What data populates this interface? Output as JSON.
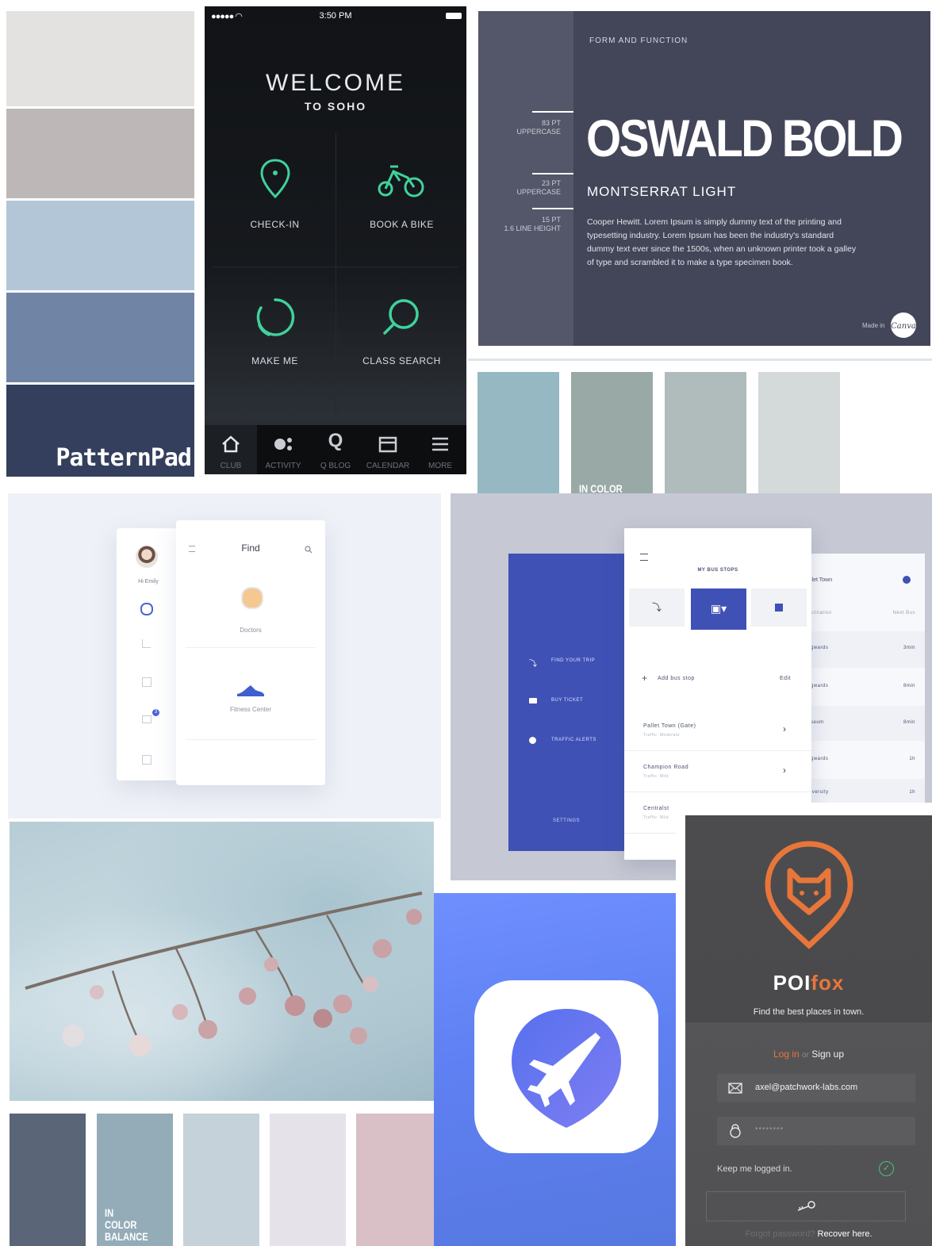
{
  "palette_left": {
    "colors": [
      "#e4e2e1",
      "#bdb8b7",
      "#b3c6d8",
      "#7085a6",
      "#333f5c"
    ],
    "logo": "PatternPad"
  },
  "soho": {
    "status": {
      "time": "3:50 PM"
    },
    "title": "WELCOME",
    "subtitle": "TO SOHO",
    "tiles": [
      {
        "label": "CHECK-IN",
        "icon": "location-pin-icon"
      },
      {
        "label": "BOOK A BIKE",
        "icon": "bicycle-icon"
      },
      {
        "label": "MAKE ME",
        "icon": "loop-icon"
      },
      {
        "label": "CLASS SEARCH",
        "icon": "search-icon"
      }
    ],
    "tabs": [
      {
        "label": "CLUB",
        "icon": "home-icon"
      },
      {
        "label": "ACTIVITY",
        "icon": "activity-icon"
      },
      {
        "label": "Q BLOG",
        "icon": "q-icon"
      },
      {
        "label": "CALENDAR",
        "icon": "calendar-icon"
      },
      {
        "label": "MORE",
        "icon": "menu-icon"
      }
    ],
    "accent": "#3fd29b"
  },
  "typography": {
    "kicker": "FORM AND FUNCTION",
    "specs": [
      {
        "size": "83 PT",
        "case": "UPPERCASE"
      },
      {
        "size": "23 PT",
        "case": "UPPERCASE"
      },
      {
        "size": "15 PT",
        "case": "1.6 LINE HEIGHT"
      }
    ],
    "headline": "OSWALD BOLD",
    "subhead": "MONTSERRAT LIGHT",
    "body": "Cooper Hewitt. Lorem Ipsum is simply dummy text of the printing and typesetting industry. Lorem Ipsum has been the industry's standard dummy text ever since the 1500s, when an unknown printer took a galley of type and scrambled it to make a type specimen book.",
    "made_in": "Made in",
    "brand": "Canva"
  },
  "palette_right": {
    "colors": [
      "#96b8c2",
      "#99a9a6",
      "#b0bcbc",
      "#d4d9da"
    ],
    "caption": "IN COLOR BALANCE"
  },
  "find_app": {
    "greeting": "Hi Emily",
    "title": "Find",
    "badge": "3",
    "categories": [
      {
        "label": "Doctors"
      },
      {
        "label": "Fitness Center"
      }
    ]
  },
  "bus_app": {
    "menu": [
      "FIND YOUR TRIP",
      "BUY TICKET",
      "TRAFFIC ALERTS"
    ],
    "settings": "SETTINGS",
    "title": "MY BUS STOPS",
    "add_label": "Add bus stop",
    "edit_label": "Edit",
    "stops": [
      {
        "name": "Pallet Town (Gate)",
        "sub": "Traffic: Moderate"
      },
      {
        "name": "Champion Road",
        "sub": "Traffic: Mild"
      },
      {
        "name": "Centralst",
        "sub": "Traffic: Mild"
      }
    ],
    "detail": {
      "title": "llet Town",
      "col_a": "stination",
      "col_b": "Next Bus",
      "rows": [
        {
          "dest": "gwards",
          "next": "3min"
        },
        {
          "dest": "gwards",
          "next": "8min"
        },
        {
          "dest": "seum",
          "next": "8min"
        },
        {
          "dest": "gwards",
          "next": "1h"
        },
        {
          "dest": "iversity",
          "next": "1h"
        }
      ]
    },
    "accent": "#3f51b5"
  },
  "palette_bottom": {
    "colors": [
      "#5a6577",
      "#94acb8",
      "#c6d2da",
      "#e5e2ea",
      "#d8c0c6"
    ],
    "caption": "IN COLOR BALANCE"
  },
  "travel_icon": {
    "icon": "airplane-pin-icon",
    "gradient": [
      "#6d8dff",
      "#5675e0"
    ]
  },
  "poifox": {
    "logo_a": "POI",
    "logo_b": "fox",
    "tagline": "Find the best places in town.",
    "login": "Log in",
    "or": "or",
    "signup": "Sign up",
    "email": "axel@patchwork-labs.com",
    "password": "••••••••",
    "keep_logged": "Keep me logged in.",
    "forgot": "Forgot password?",
    "recover": "Recover here.",
    "accent": "#e8763a"
  }
}
